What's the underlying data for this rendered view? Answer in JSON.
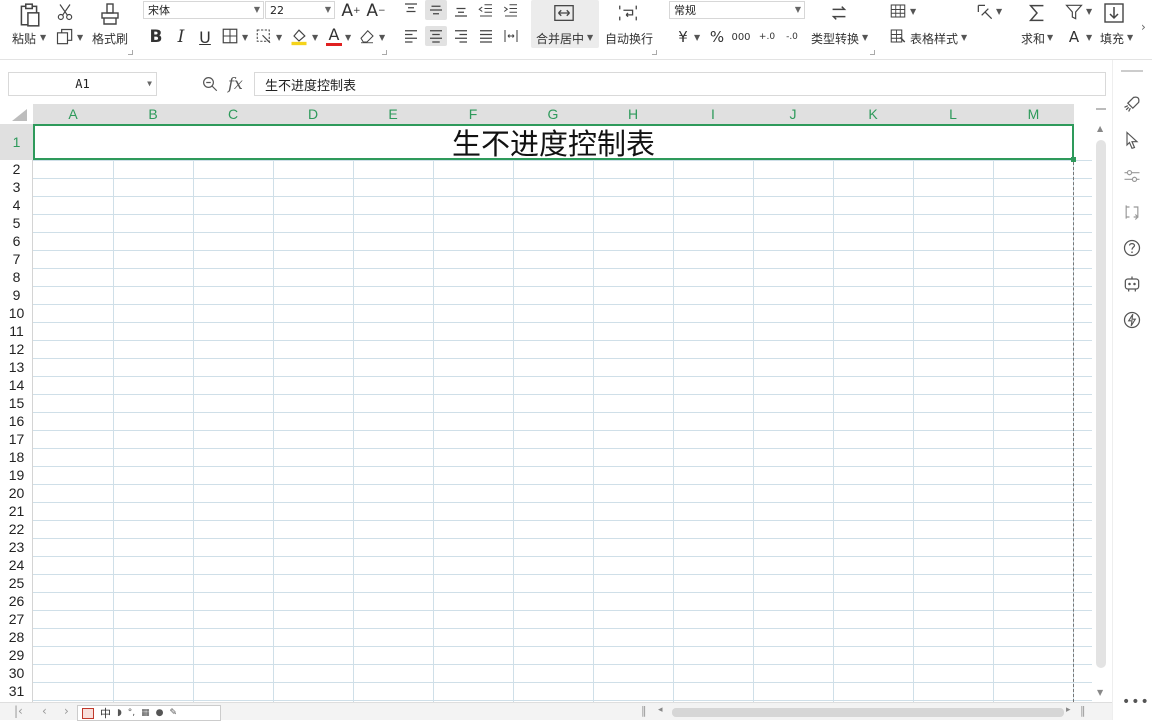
{
  "ribbon": {
    "paste_label": "粘贴",
    "format_painter_label": "格式刷",
    "font_name": "宋体",
    "font_size": "22",
    "bold": "B",
    "italic": "I",
    "underline": "U",
    "merge_center_label": "合并居中",
    "wrap_text_label": "自动换行",
    "number_format": "常规",
    "currency_symbol": "¥",
    "percent_symbol": "%",
    "thousands_symbol": "000",
    "dec_increase": "+.0",
    "dec_decrease": "-.0",
    "type_convert_label": "类型转换",
    "table_style_label": "表格样式",
    "sum_label": "求和",
    "fill_label": "填充",
    "grow_font": "A",
    "shrink_font": "A",
    "font_color_letter": "A",
    "sort_letter": "A"
  },
  "formula_bar": {
    "cell_ref": "A1",
    "fx_label": "fx",
    "content": "生不进度控制表"
  },
  "sheet": {
    "columns": [
      "A",
      "B",
      "C",
      "D",
      "E",
      "F",
      "G",
      "H",
      "I",
      "J",
      "K",
      "L",
      "M"
    ],
    "rows": [
      "1",
      "2",
      "3",
      "4",
      "5",
      "6",
      "7",
      "8",
      "9",
      "10",
      "11",
      "12",
      "13",
      "14",
      "15",
      "16",
      "17",
      "18",
      "19",
      "20",
      "21",
      "22",
      "23",
      "24",
      "25",
      "26",
      "27",
      "28",
      "29",
      "30",
      "31"
    ],
    "title_cell": "生不进度控制表"
  },
  "bottom": {
    "sheet_tab_text": "中"
  },
  "colors": {
    "accent_green": "#2e9a5b",
    "grid_line": "#cfdfe8",
    "header_bg": "#e0e0e0"
  }
}
